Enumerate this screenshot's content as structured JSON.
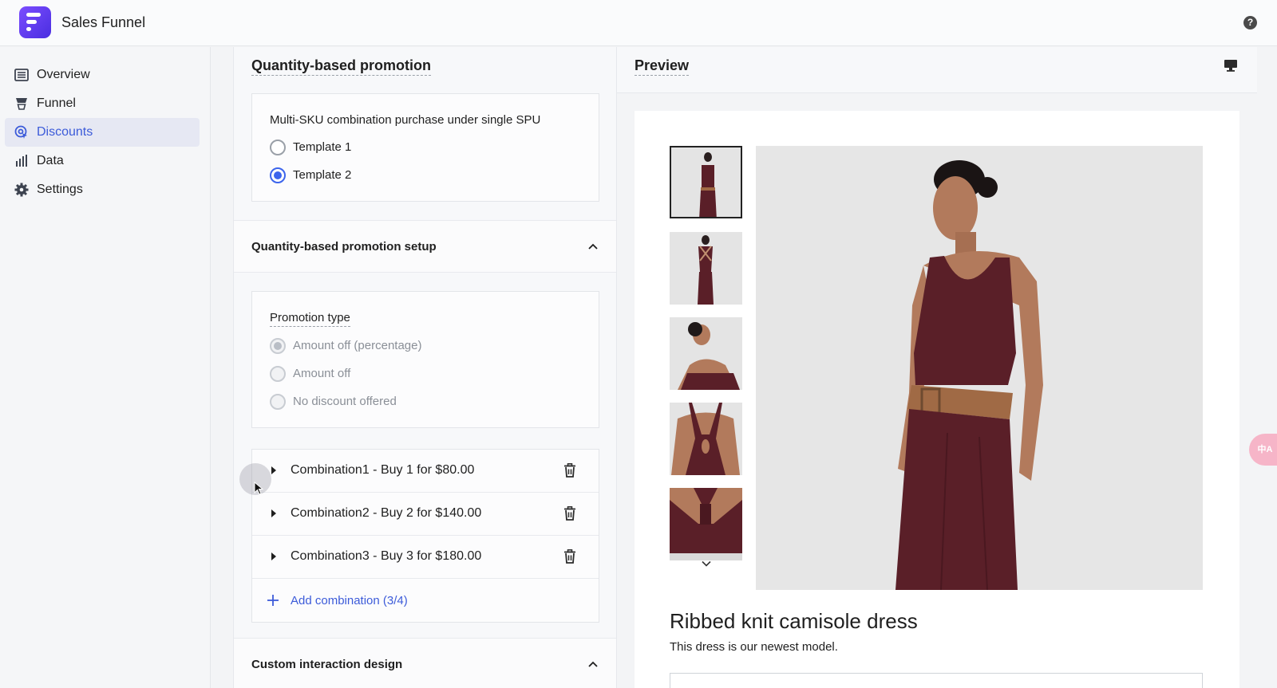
{
  "app": {
    "title": "Sales Funnel"
  },
  "sidebar": {
    "items": [
      {
        "label": "Overview",
        "icon": "list-icon",
        "active": false
      },
      {
        "label": "Funnel",
        "icon": "funnel-icon",
        "active": false
      },
      {
        "label": "Discounts",
        "icon": "discount-icon",
        "active": true
      },
      {
        "label": "Data",
        "icon": "bar-chart-icon",
        "active": false
      },
      {
        "label": "Settings",
        "icon": "gear-icon",
        "active": false
      }
    ]
  },
  "editor": {
    "title": "Quantity-based promotion",
    "template_question": "Multi-SKU combination purchase under single SPU",
    "templates": [
      {
        "label": "Template 1",
        "selected": false
      },
      {
        "label": "Template 2",
        "selected": true
      }
    ],
    "setup_title": "Quantity-based promotion setup",
    "promotion_type_label": "Promotion type",
    "promotion_types": [
      {
        "label": "Amount off (percentage)",
        "selected": true,
        "disabled": true
      },
      {
        "label": "Amount off",
        "selected": false,
        "disabled": true
      },
      {
        "label": "No discount offered",
        "selected": false,
        "disabled": true
      }
    ],
    "combinations": [
      {
        "label": "Combination1 - Buy 1 for $80.00"
      },
      {
        "label": "Combination2 - Buy 2 for $140.00"
      },
      {
        "label": "Combination3 - Buy 3 for $180.00"
      }
    ],
    "add_combination_label": "Add combination (3/4)",
    "custom_design_title": "Custom interaction design"
  },
  "preview": {
    "title": "Preview",
    "product_title": "Ribbed knit camisole dress",
    "product_description": "This dress is our newest model.",
    "thumbnail_count": 5
  },
  "translate_badge": "中A",
  "colors": {
    "accent": "#3c5bd9",
    "radio_on": "#3c64ec",
    "dress": "#5a1f28",
    "belt": "#a06a45"
  }
}
